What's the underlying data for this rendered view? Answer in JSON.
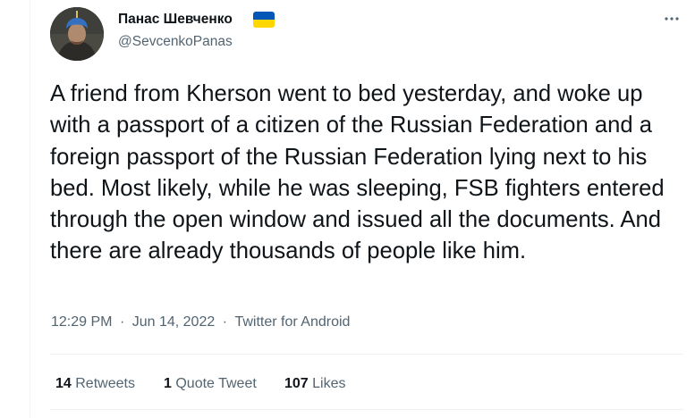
{
  "author": {
    "name": "Панас Шевченко",
    "handle": "@SevcenkoPanas",
    "flag_icon": "ukraine-flag-icon"
  },
  "tweet": {
    "text": "A friend from Kherson went to bed yesterday, and woke up with a passport of a citizen of the Russian Federation and a foreign passport of the Russian Federation lying next to his bed. Most likely, while he was sleeping, FSB fighters entered through the open window and issued all the documents. And there are already thousands of people like him.",
    "time": "12:29 PM",
    "date": "Jun 14, 2022",
    "source": "Twitter for Android",
    "separator": "·"
  },
  "stats": {
    "retweets_count": "14",
    "retweets_label": "Retweets",
    "quotes_count": "1",
    "quotes_label": "Quote Tweet",
    "likes_count": "107",
    "likes_label": "Likes"
  },
  "colors": {
    "text": "#0f1419",
    "secondary": "#536471",
    "divider": "#eff3f4",
    "flag_blue": "#0057b7",
    "flag_yellow": "#ffd700"
  }
}
